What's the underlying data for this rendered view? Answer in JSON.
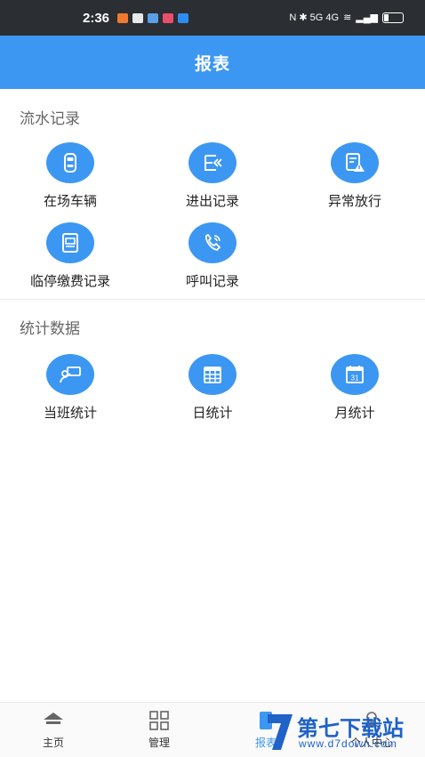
{
  "status_bar": {
    "time": "2:36",
    "right_text": "N ✱ 5G 4G"
  },
  "header": {
    "title": "报表"
  },
  "sections": [
    {
      "title": "流水记录",
      "items": [
        {
          "label": "在场车辆",
          "icon": "car-icon"
        },
        {
          "label": "进出记录",
          "icon": "entry-exit-icon"
        },
        {
          "label": "异常放行",
          "icon": "warning-doc-icon"
        },
        {
          "label": "临停缴费记录",
          "icon": "payment-doc-icon"
        },
        {
          "label": "呼叫记录",
          "icon": "phone-call-icon"
        }
      ]
    },
    {
      "title": "统计数据",
      "items": [
        {
          "label": "当班统计",
          "icon": "shift-stats-icon"
        },
        {
          "label": "日统计",
          "icon": "calendar-grid-icon"
        },
        {
          "label": "月统计",
          "icon": "calendar-month-icon"
        }
      ]
    }
  ],
  "calendar_day": "31",
  "bottom_nav": [
    {
      "label": "主页",
      "icon": "home-icon"
    },
    {
      "label": "管理",
      "icon": "grid-icon"
    },
    {
      "label": "报表",
      "icon": "report-icon"
    },
    {
      "label": "个人中心",
      "icon": "user-icon"
    }
  ],
  "watermark": {
    "brand": "第七下载站",
    "url": "www.d7down.com"
  },
  "colors": {
    "primary": "#3c97f2",
    "status_bar": "#2b2e33"
  }
}
